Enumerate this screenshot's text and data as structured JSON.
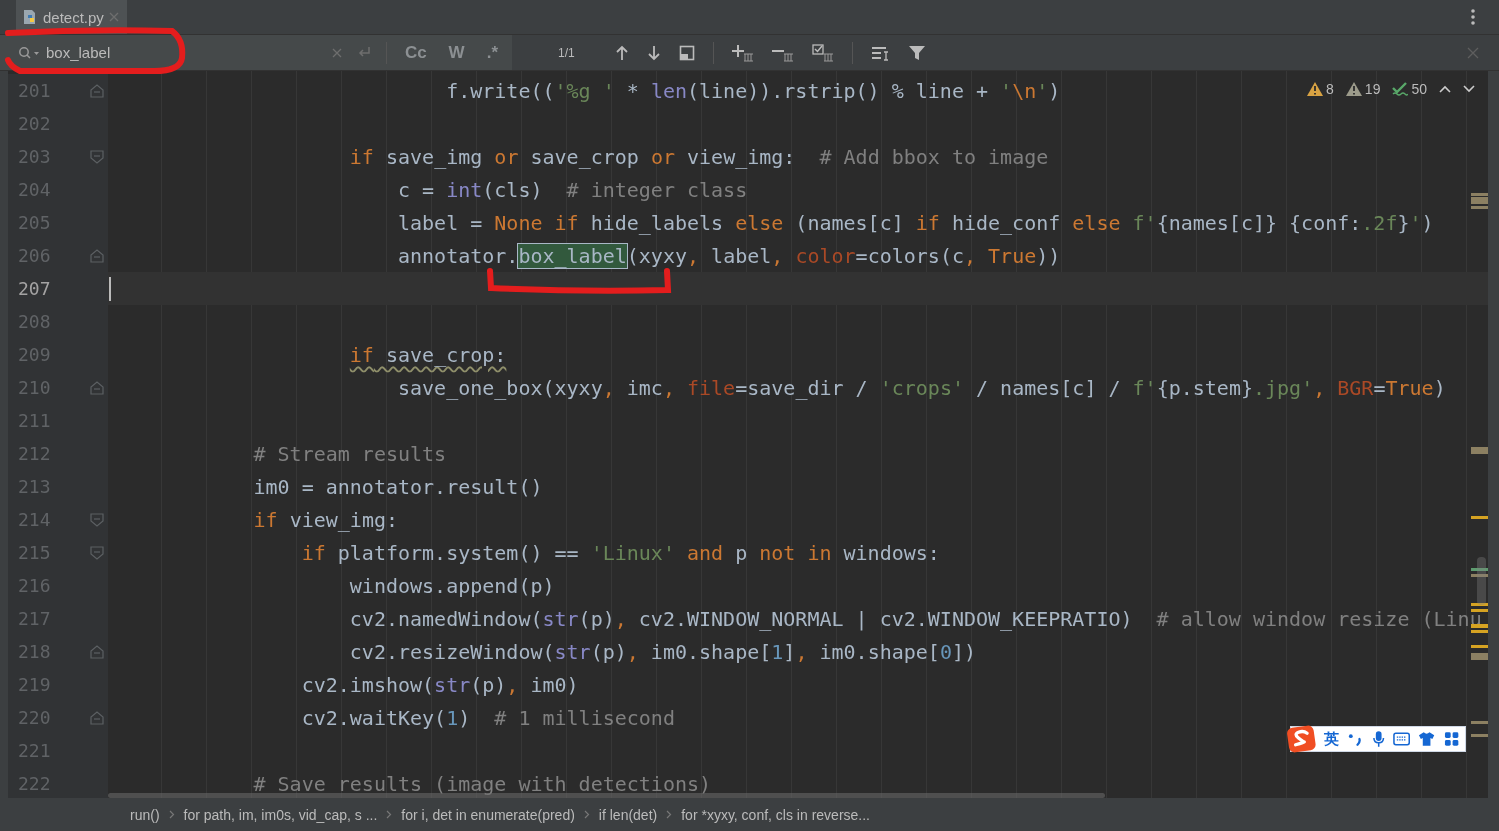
{
  "tab": {
    "label": "detect.py",
    "selected": true
  },
  "search": {
    "value": "box_label",
    "toggles": [
      {
        "label": "Cc",
        "on": false
      },
      {
        "label": "W",
        "on": false
      },
      {
        "label": ".*",
        "on": false
      }
    ],
    "match_count": "1/1"
  },
  "inspections": [
    {
      "kind": "warning",
      "count": "8"
    },
    {
      "kind": "weak_warning",
      "count": "19"
    },
    {
      "kind": "typo",
      "count": "50"
    }
  ],
  "lines": [
    {
      "n": "201",
      "current": false,
      "fold_start": false,
      "fold_end": true,
      "warn": false,
      "tokens": [
        {
          "kind": "plain",
          "t": "                            f.write(("
        },
        {
          "kind": "string",
          "t": "'%g '"
        },
        {
          "kind": "plain",
          "t": " * "
        },
        {
          "kind": "builtin",
          "t": "len"
        },
        {
          "kind": "plain",
          "t": "(line)).rstrip() % line + "
        },
        {
          "kind": "string",
          "t": "'"
        },
        {
          "kind": "keyword",
          "t": "\\n"
        },
        {
          "kind": "string",
          "t": "'"
        },
        {
          "kind": "plain",
          "t": ")"
        }
      ]
    },
    {
      "n": "202",
      "current": false,
      "fold_start": false,
      "fold_end": false
    },
    {
      "n": "203",
      "current": false,
      "fold_start": true,
      "fold_end": false,
      "warn": false,
      "tokens": [
        {
          "kind": "keyword",
          "t": "                    if"
        },
        {
          "kind": "plain",
          "t": " save_img "
        },
        {
          "kind": "keyword",
          "t": "or"
        },
        {
          "kind": "plain",
          "t": " save_crop "
        },
        {
          "kind": "keyword",
          "t": "or"
        },
        {
          "kind": "plain",
          "t": " view_img:  "
        },
        {
          "kind": "comment",
          "t": "# Add bbox to image"
        }
      ]
    },
    {
      "n": "204",
      "current": false,
      "fold_start": false,
      "fold_end": false,
      "warn": false,
      "tokens": [
        {
          "kind": "plain",
          "t": "                        c = "
        },
        {
          "kind": "builtin",
          "t": "int"
        },
        {
          "kind": "plain",
          "t": "(cls)  "
        },
        {
          "kind": "comment",
          "t": "# integer class"
        }
      ]
    },
    {
      "n": "205",
      "current": false,
      "fold_start": false,
      "fold_end": false,
      "warn": false,
      "tokens": [
        {
          "kind": "plain",
          "t": "                        label = "
        },
        {
          "kind": "keyword",
          "t": "None if"
        },
        {
          "kind": "plain",
          "t": " hide_labels "
        },
        {
          "kind": "keyword",
          "t": "else"
        },
        {
          "kind": "plain",
          "t": " (names[c] "
        },
        {
          "kind": "keyword",
          "t": "if"
        },
        {
          "kind": "plain",
          "t": " hide_conf "
        },
        {
          "kind": "keyword",
          "t": "else"
        },
        {
          "kind": "string",
          "t": " f'"
        },
        {
          "kind": "plain",
          "t": "{names[c]} {conf:"
        },
        {
          "kind": "string",
          "t": ".2f"
        },
        {
          "kind": "plain",
          "t": "}"
        },
        {
          "kind": "string",
          "t": "'"
        },
        {
          "kind": "plain",
          "t": ")"
        }
      ]
    },
    {
      "n": "206",
      "current": false,
      "fold_start": false,
      "fold_end": true,
      "warn": false,
      "tokens": [
        {
          "kind": "plain",
          "t": "                        annotator."
        },
        {
          "kind": "match",
          "t": "box_label"
        },
        {
          "kind": "plain",
          "t": "(xyxy"
        },
        {
          "kind": "keyword",
          "t": ","
        },
        {
          "kind": "plain",
          "t": " label"
        },
        {
          "kind": "keyword",
          "t": ","
        },
        {
          "kind": "param",
          "t": " color"
        },
        {
          "kind": "plain",
          "t": "=colors(c"
        },
        {
          "kind": "keyword",
          "t": ", True"
        },
        {
          "kind": "plain",
          "t": "))"
        }
      ]
    },
    {
      "n": "207",
      "current": true,
      "fold_start": false,
      "fold_end": false
    },
    {
      "n": "208",
      "current": false,
      "fold_start": false,
      "fold_end": false
    },
    {
      "n": "209",
      "current": false,
      "fold_start": false,
      "fold_end": false,
      "warn": true,
      "tokens": [
        {
          "kind": "keyword",
          "t": "                    if"
        },
        {
          "kind": "plain",
          "t": " save_crop:"
        }
      ]
    },
    {
      "n": "210",
      "current": false,
      "fold_start": false,
      "fold_end": true,
      "warn": false,
      "tokens": [
        {
          "kind": "plain",
          "t": "                        save_one_box(xyxy"
        },
        {
          "kind": "keyword",
          "t": ","
        },
        {
          "kind": "plain",
          "t": " imc"
        },
        {
          "kind": "keyword",
          "t": ","
        },
        {
          "kind": "param",
          "t": " file"
        },
        {
          "kind": "plain",
          "t": "=save_dir / "
        },
        {
          "kind": "string",
          "t": "'crops'"
        },
        {
          "kind": "plain",
          "t": " / names[c] / "
        },
        {
          "kind": "string",
          "t": "f'"
        },
        {
          "kind": "plain",
          "t": "{p.stem}"
        },
        {
          "kind": "string",
          "t": ".jpg'"
        },
        {
          "kind": "keyword",
          "t": ","
        },
        {
          "kind": "param",
          "t": " BGR"
        },
        {
          "kind": "plain",
          "t": "="
        },
        {
          "kind": "keyword",
          "t": "True"
        },
        {
          "kind": "plain",
          "t": ")"
        }
      ]
    },
    {
      "n": "211",
      "current": false,
      "fold_start": false,
      "fold_end": false
    },
    {
      "n": "212",
      "current": false,
      "fold_start": false,
      "fold_end": false,
      "warn": false,
      "tokens": [
        {
          "kind": "comment",
          "t": "            # Stream results"
        }
      ]
    },
    {
      "n": "213",
      "current": false,
      "fold_start": false,
      "fold_end": false,
      "warn": false,
      "tokens": [
        {
          "kind": "plain",
          "t": "            im0 = annotator.result()"
        }
      ]
    },
    {
      "n": "214",
      "current": false,
      "fold_start": true,
      "fold_end": false,
      "warn": false,
      "tokens": [
        {
          "kind": "keyword",
          "t": "            if"
        },
        {
          "kind": "plain",
          "t": " view_img:"
        }
      ]
    },
    {
      "n": "215",
      "current": false,
      "fold_start": true,
      "fold_end": false,
      "warn": false,
      "tokens": [
        {
          "kind": "keyword",
          "t": "                if"
        },
        {
          "kind": "plain",
          "t": " platform.system() == "
        },
        {
          "kind": "string",
          "t": "'Linux'"
        },
        {
          "kind": "keyword",
          "t": " and"
        },
        {
          "kind": "plain",
          "t": " p "
        },
        {
          "kind": "keyword",
          "t": "not in"
        },
        {
          "kind": "plain",
          "t": " windows:"
        }
      ]
    },
    {
      "n": "216",
      "current": false,
      "fold_start": false,
      "fold_end": false,
      "warn": false,
      "tokens": [
        {
          "kind": "plain",
          "t": "                    windows.append(p)"
        }
      ]
    },
    {
      "n": "217",
      "current": false,
      "fold_start": false,
      "fold_end": false,
      "warn": false,
      "tokens": [
        {
          "kind": "plain",
          "t": "                    cv2.namedWindow("
        },
        {
          "kind": "builtin",
          "t": "str"
        },
        {
          "kind": "plain",
          "t": "(p)"
        },
        {
          "kind": "keyword",
          "t": ","
        },
        {
          "kind": "plain",
          "t": " cv2.WINDOW_NORMAL | cv2.WINDOW_KEEPRATIO)  "
        },
        {
          "kind": "comment",
          "t": "# allow window resize (Linu"
        }
      ]
    },
    {
      "n": "218",
      "current": false,
      "fold_start": false,
      "fold_end": true,
      "warn": false,
      "tokens": [
        {
          "kind": "plain",
          "t": "                    cv2.resizeWindow("
        },
        {
          "kind": "builtin",
          "t": "str"
        },
        {
          "kind": "plain",
          "t": "(p)"
        },
        {
          "kind": "keyword",
          "t": ","
        },
        {
          "kind": "plain",
          "t": " im0.shape["
        },
        {
          "kind": "number",
          "t": "1"
        },
        {
          "kind": "plain",
          "t": "]"
        },
        {
          "kind": "keyword",
          "t": ","
        },
        {
          "kind": "plain",
          "t": " im0.shape["
        },
        {
          "kind": "number",
          "t": "0"
        },
        {
          "kind": "plain",
          "t": "])"
        }
      ]
    },
    {
      "n": "219",
      "current": false,
      "fold_start": false,
      "fold_end": false,
      "warn": false,
      "tokens": [
        {
          "kind": "plain",
          "t": "                cv2.imshow("
        },
        {
          "kind": "builtin",
          "t": "str"
        },
        {
          "kind": "plain",
          "t": "(p)"
        },
        {
          "kind": "keyword",
          "t": ","
        },
        {
          "kind": "plain",
          "t": " im0)"
        }
      ]
    },
    {
      "n": "220",
      "current": false,
      "fold_start": false,
      "fold_end": true,
      "warn": false,
      "tokens": [
        {
          "kind": "plain",
          "t": "                cv2.waitKey("
        },
        {
          "kind": "number",
          "t": "1"
        },
        {
          "kind": "plain",
          "t": ")  "
        },
        {
          "kind": "comment",
          "t": "# 1 millisecond"
        }
      ]
    },
    {
      "n": "221",
      "current": false,
      "fold_start": false,
      "fold_end": false
    },
    {
      "n": "222",
      "current": false,
      "fold_start": false,
      "fold_end": false,
      "warn": false,
      "tokens": [
        {
          "kind": "comment",
          "t": "            # Save results (image with detections)"
        }
      ]
    }
  ],
  "breadcrumbs": [
    "run()",
    "for path, im, im0s, vid_cap, s ...",
    "for i, det in enumerate(pred)",
    "if len(det)",
    "for *xyxy, conf, cls in reverse..."
  ],
  "ime": {
    "mode": "英"
  }
}
